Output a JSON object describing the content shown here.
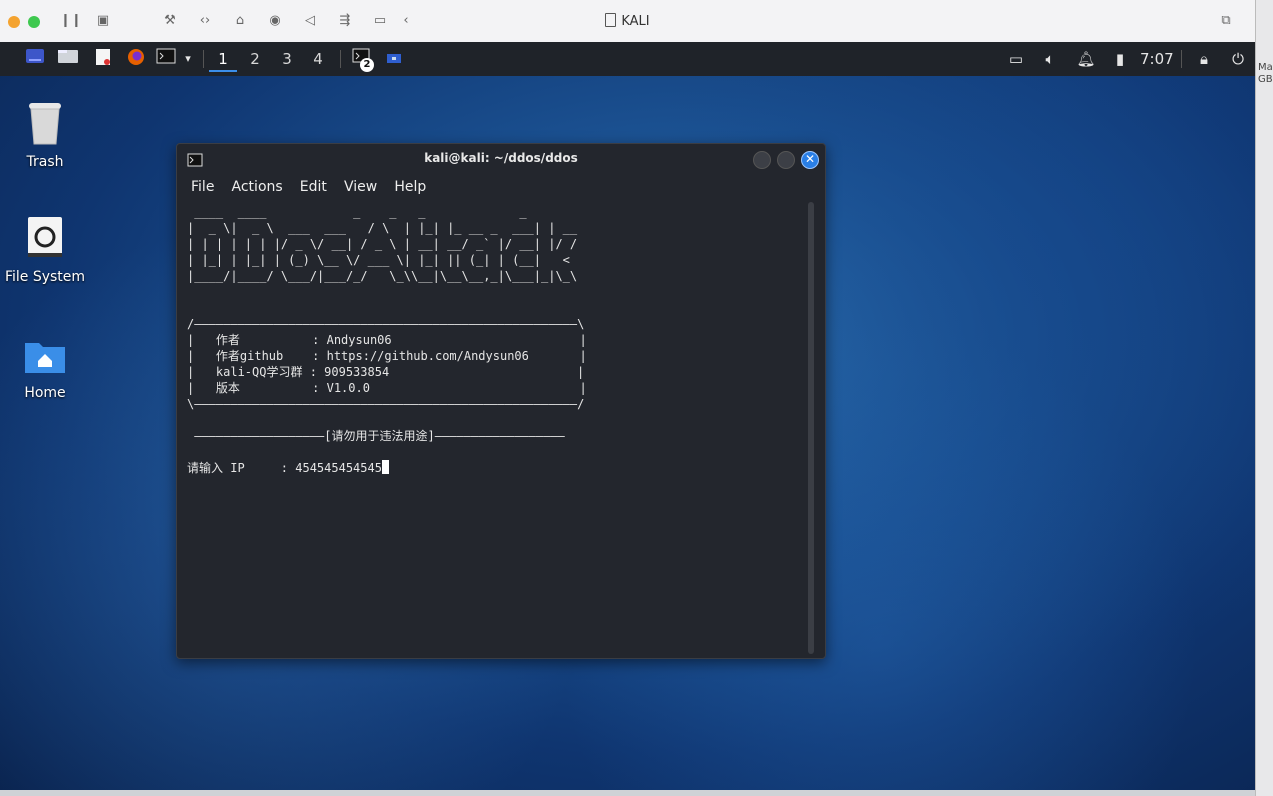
{
  "host": {
    "title": "KALI",
    "side_text": "Mac GB"
  },
  "panel": {
    "workspaces": [
      "1",
      "2",
      "3",
      "4"
    ],
    "active_workspace": "1",
    "task_badge": "2",
    "clock": "7:07"
  },
  "desktop": {
    "icons": [
      {
        "label": "Trash",
        "icon": "trash-icon"
      },
      {
        "label": "File System",
        "icon": "drive-icon"
      },
      {
        "label": "Home",
        "icon": "home-folder-icon"
      }
    ]
  },
  "terminal": {
    "title": "kali@kali: ~/ddos/ddos",
    "menu": [
      "File",
      "Actions",
      "Edit",
      "View",
      "Help"
    ],
    "banner": " ____  ____            _    _   _             _\n|  _ \\|  _ \\  ___  ___   / \\  | |_| |_ __ _  ___| | __\n| | | | | | |/ _ \\/ __| / _ \\ | __| __/ _` |/ __| |/ /\n| |_| | |_| | (_) \\__ \\/ ___ \\| |_| || (_| | (__|   <\n|____/|____/ \\___/|___/_/   \\_\\\\__|\\__\\__,_|\\___|_|\\_\\",
    "info_box": "/—————————————————————————————————————————————————————\\\n|   作者          : Andysun06                          |\n|   作者github    : https://github.com/Andysun06       |\n|   kali-QQ学习群 : 909533854                          |\n|   版本          : V1.0.0                             |\n\\—————————————————————————————————————————————————————/",
    "warning": " ——————————————————[请勿用于违法用途]——————————————————",
    "prompt_label": "请输入 IP     : ",
    "prompt_value": "454545454545"
  },
  "colors": {
    "panel_bg": "#1f2329",
    "terminal_bg": "#23262d",
    "close_button": "#2a7fe6",
    "accent_blue": "#3b8eea"
  }
}
